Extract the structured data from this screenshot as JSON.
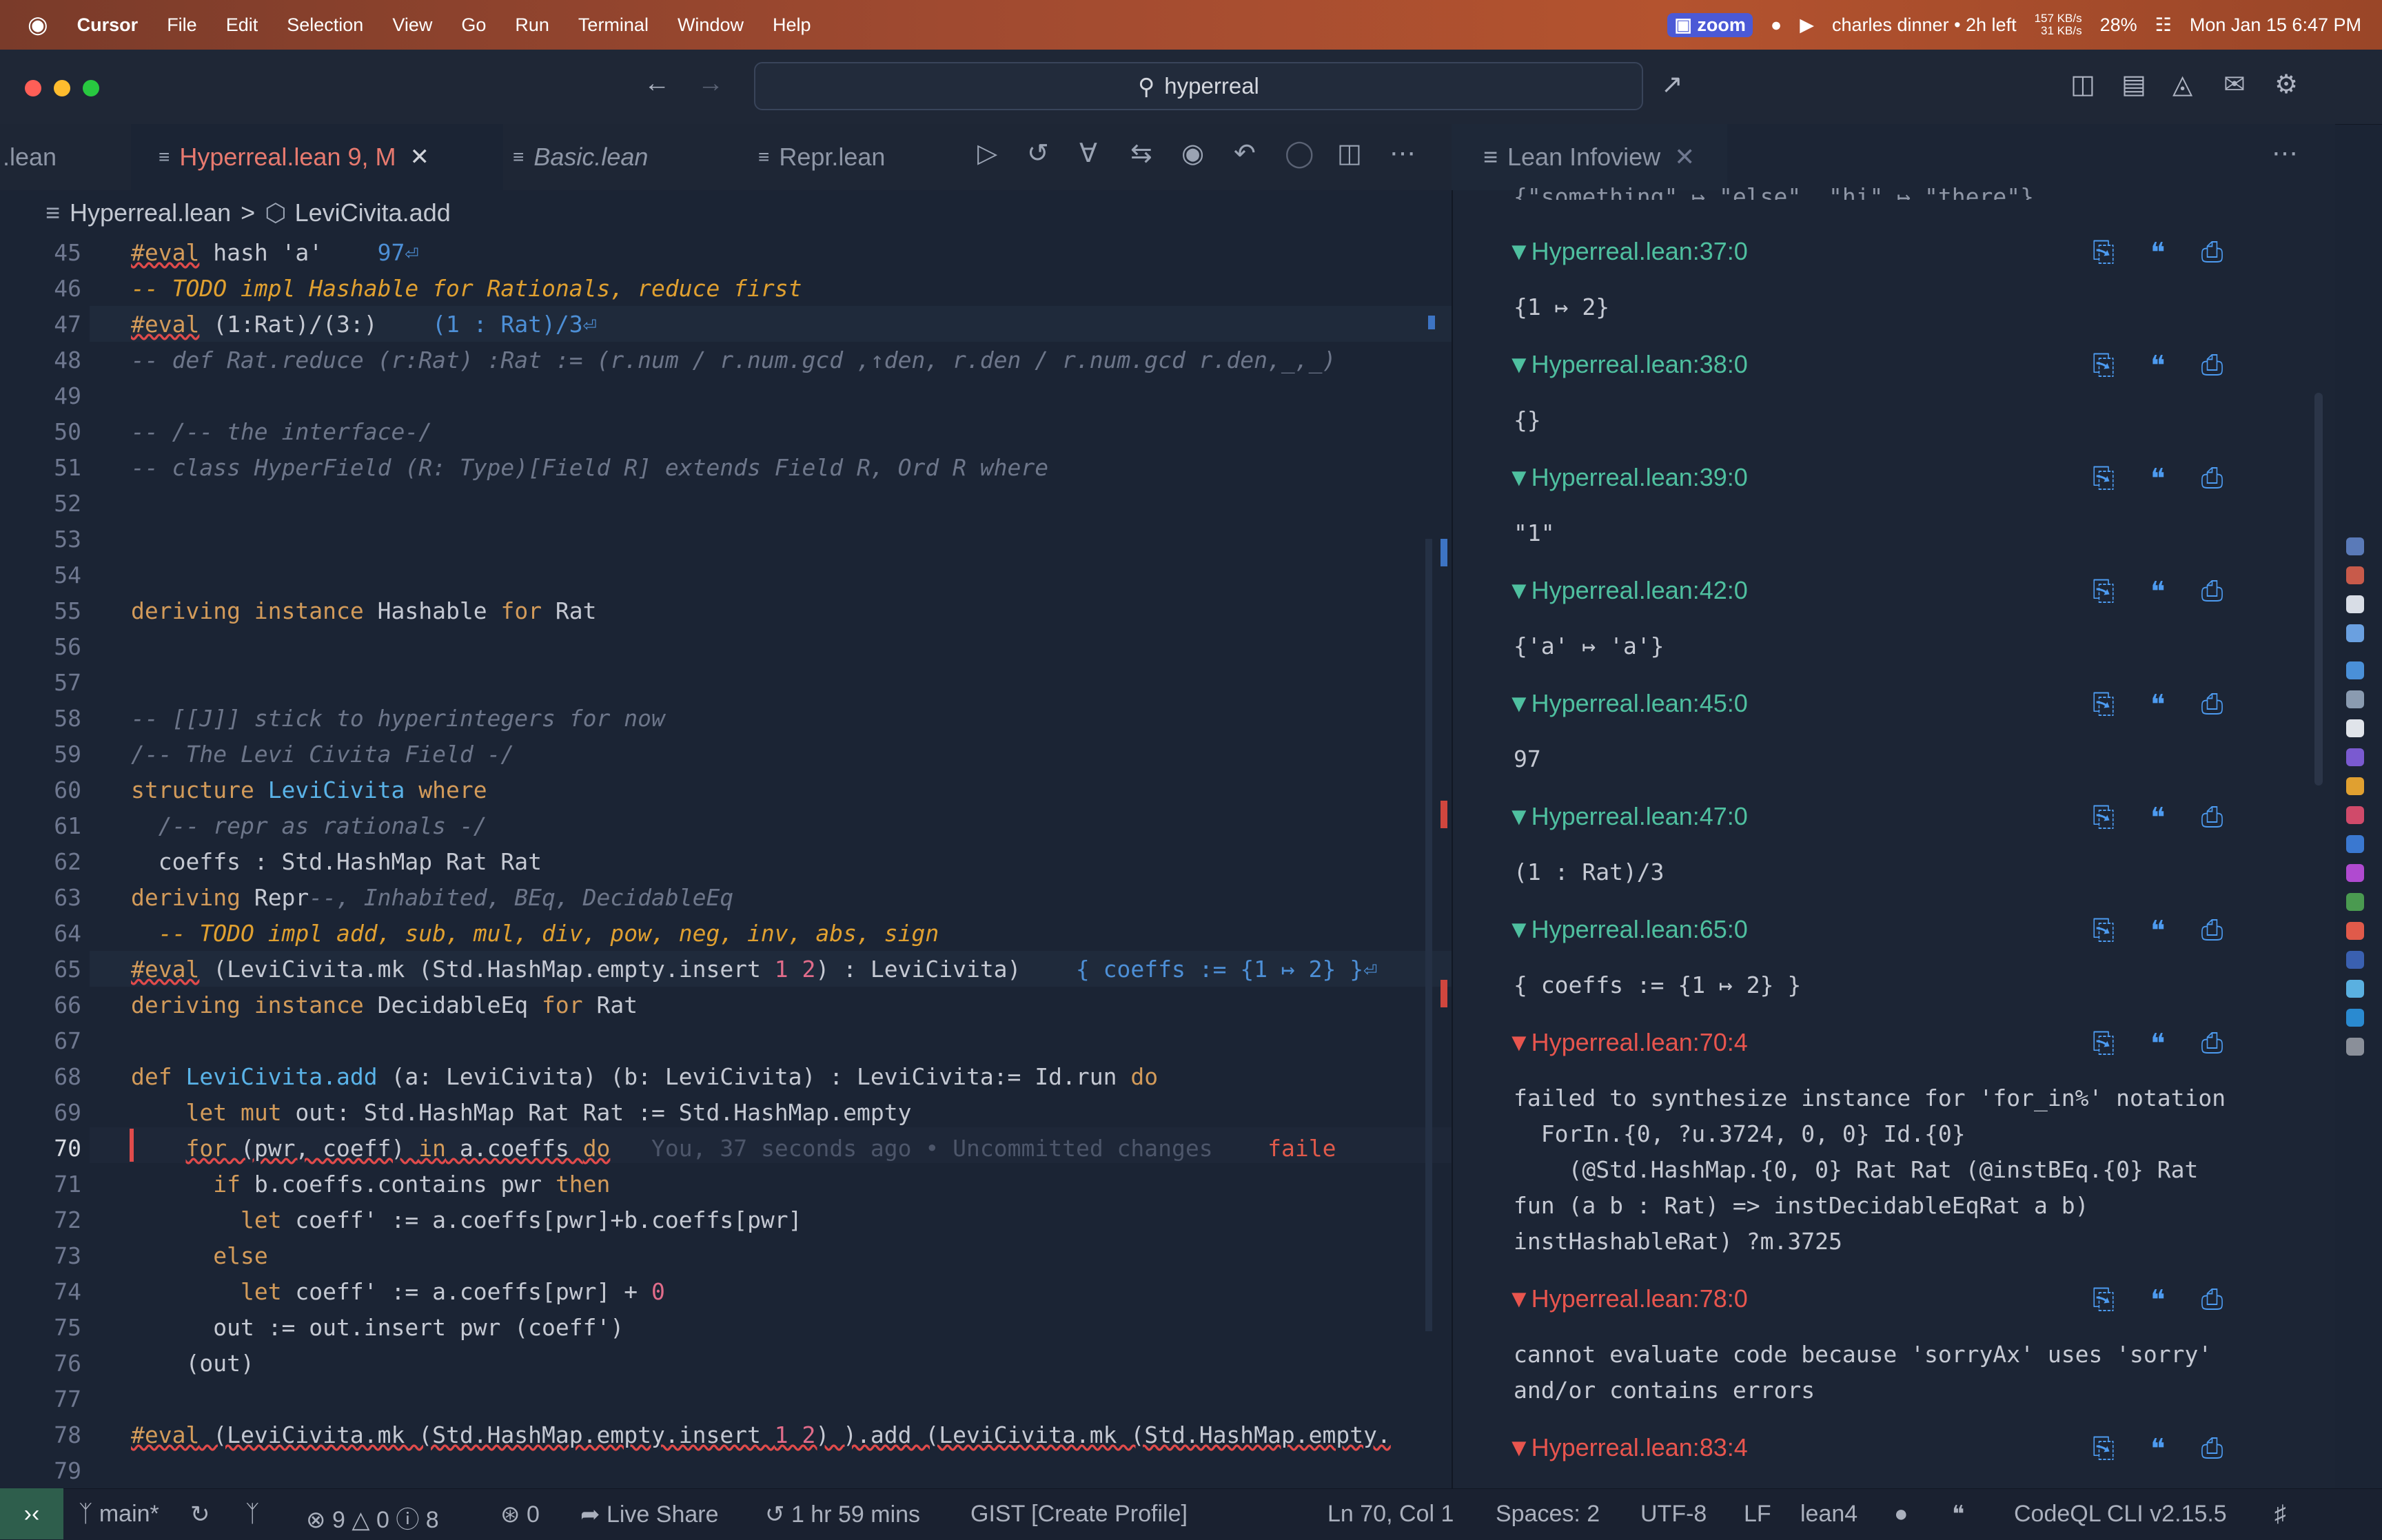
{
  "menubar": {
    "apple": "",
    "app": "Cursor",
    "items": [
      "File",
      "Edit",
      "Selection",
      "View",
      "Go",
      "Run",
      "Terminal",
      "Window",
      "Help"
    ],
    "zoom": "zoom",
    "calendar": "charles dinner • 2h left",
    "net_up": "157 KB/s",
    "net_down": "31 KB/s",
    "battery": "28%",
    "datetime": "Mon Jan 15  6:47 PM"
  },
  "titlebar": {
    "search": "hyperreal"
  },
  "tabs": [
    {
      "label": ".lean",
      "badge": ""
    },
    {
      "label": "Hyperreal.lean",
      "badge": "9, M"
    },
    {
      "label": "Basic.lean",
      "badge": ""
    },
    {
      "label": "Repr.lean",
      "badge": ""
    }
  ],
  "breadcrumb": {
    "file": "Hyperreal.lean",
    "sep": ">",
    "symbol": "LeviCivita.add"
  },
  "editor": {
    "line_numbers": [
      "45",
      "46",
      "47",
      "48",
      "49",
      "50",
      "51",
      "52",
      "53",
      "54",
      "55",
      "56",
      "57",
      "58",
      "59",
      "60",
      "61",
      "62",
      "63",
      "64",
      "65",
      "66",
      "67",
      "68",
      "69",
      "70",
      "71",
      "72",
      "73",
      "74",
      "75",
      "76",
      "77",
      "78",
      "79"
    ],
    "blame": "You, 37 seconds ago • Uncommitted changes",
    "failed": "faile"
  },
  "infoview": {
    "tab_label": "Lean Infoview",
    "top_clip": "{\"something\" ↦ \"else\", \"hi\" ↦ \"there\"}",
    "entries": [
      {
        "header": "Hyperreal.lean:37:0",
        "body": "{1 ↦ 2}"
      },
      {
        "header": "Hyperreal.lean:38:0",
        "body": "{}"
      },
      {
        "header": "Hyperreal.lean:39:0",
        "body": "\"1\""
      },
      {
        "header": "Hyperreal.lean:42:0",
        "body": "{'a' ↦ 'a'}"
      },
      {
        "header": "Hyperreal.lean:45:0",
        "body": "97"
      },
      {
        "header": "Hyperreal.lean:47:0",
        "body": "(1 : Rat)/3"
      },
      {
        "header": "Hyperreal.lean:65:0",
        "body": "{ coeffs := {1 ↦ 2} }"
      },
      {
        "header": "Hyperreal.lean:70:4",
        "body": "failed to synthesize instance for 'for_in%' notation\n  ForIn.{0, ?u.3724, 0, 0} Id.{0}\n    (@Std.HashMap.{0, 0} Rat Rat (@instBEq.{0} Rat\nfun (a b : Rat) => instDecidableEqRat a b)\ninstHashableRat) ?m.3725"
      },
      {
        "header": "Hyperreal.lean:78:0",
        "body": "cannot evaluate code because 'sorryAx' uses 'sorry'\nand/or contains errors"
      },
      {
        "header": "Hyperreal.lean:83:4",
        "body": ""
      }
    ]
  },
  "statusbar": {
    "branch": "main*",
    "errors": "9",
    "warnings": "0",
    "infos": "8",
    "ports": "0",
    "liveshare": "Live Share",
    "timer": "1 hr 59 mins",
    "gist": "GIST [Create Profile]",
    "position": "Ln 70, Col 1",
    "spaces": "Spaces: 2",
    "encoding": "UTF-8",
    "eol": "LF",
    "language": "lean4",
    "codeql": "CodeQL CLI v2.15.5"
  },
  "colors": {
    "editor_bg": "#1b2434",
    "accent_error": "#e8554e",
    "accent_ok": "#4fc0a0",
    "icon_blue": "#4d9bf0"
  }
}
